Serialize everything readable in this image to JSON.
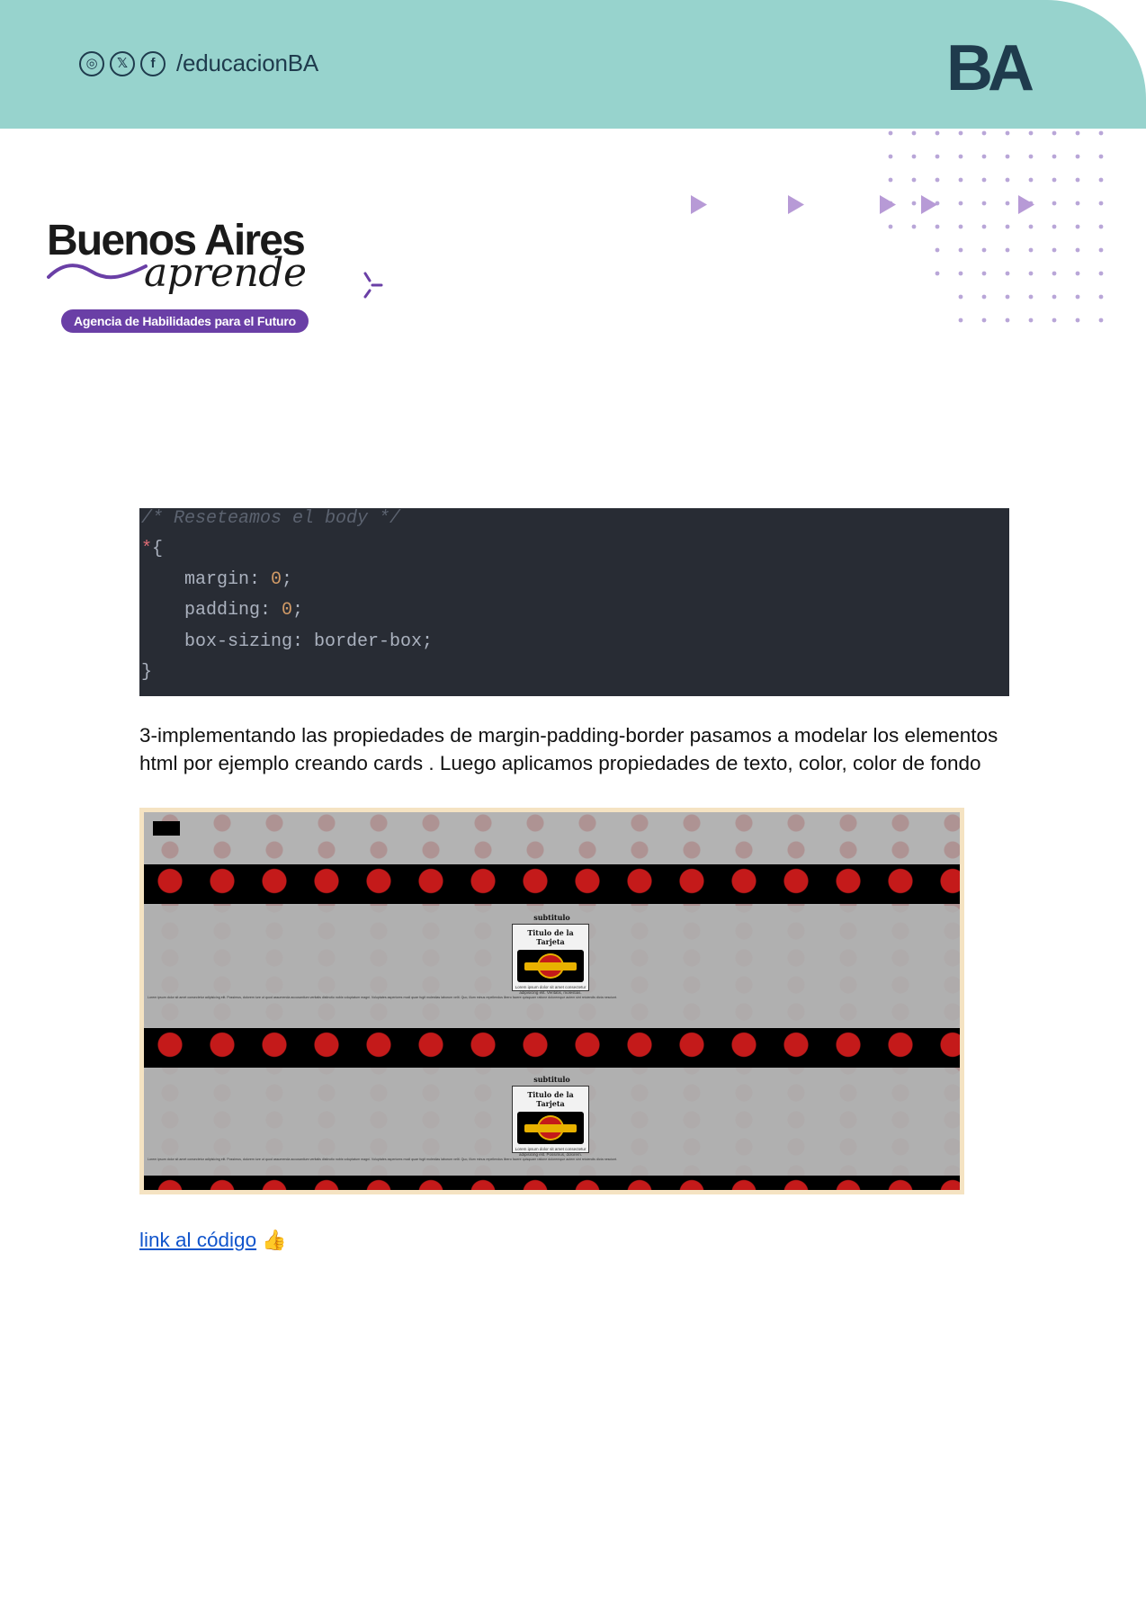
{
  "header": {
    "social_icons": [
      "instagram-icon",
      "x-icon",
      "facebook-icon"
    ],
    "handle": "/educacionBA",
    "logo_text": "BA",
    "colors": {
      "band": "#97d3cd",
      "logo": "#1f3b4d"
    }
  },
  "brand": {
    "line1": "Buenos Aires",
    "line2": "aprende",
    "tagline": "Agencia de Habilidades para el Futuro",
    "accent": "#6a3fa6"
  },
  "code": {
    "lines": [
      "/* Reseteamos el body */",
      "*{",
      "    margin: 0;",
      "    padding: 0;",
      "    box-sizing: border-box;",
      "}"
    ]
  },
  "paragraph": "3-implementando las propiedades de margin-padding-border pasamos a modelar los elementos html por ejemplo creando cards . Luego aplicamos propiedades de texto, color, color de fondo",
  "screenshot": {
    "subtitle": "subtitulo",
    "card_title": "Titulo de la Tarjeta",
    "card_logo": "JURASSIC PARK",
    "card1_text": "Lorem ipsum dolor sit amet consectetur adipisicing elit. Veritatis, molestias.",
    "card2_text": "Lorem ipsum dolor sit amet consectetur adipisicing elit. Possimus, dolorem.",
    "body_text": "Lorem ipsum dolor sit amet consectetur adipisicing elit. Possimus, dolorem iure ut quod assumenda accusantium veritatis distinctio nobis voluptatum magni. Voluptates asperiores modi quae fugit molestias laborum velit. Quo, illum minus repellendus libero facere quisquam ratione doloremque autem sint reiciendis dicta nesciunt."
  },
  "link": {
    "text": "link al código",
    "emoji": "👍"
  }
}
